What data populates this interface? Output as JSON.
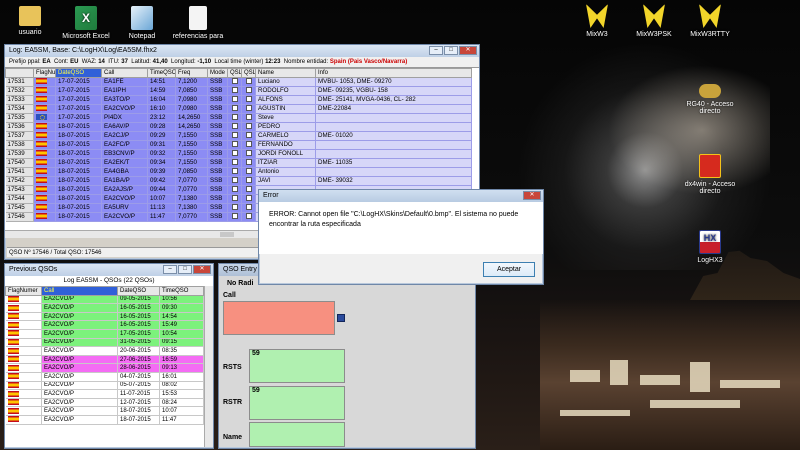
{
  "desktop": {
    "icons": [
      {
        "label": "usuario",
        "icon": "folder-icon",
        "color": "#e8c35a"
      },
      {
        "label": "Microsoft Excel",
        "icon": "excel-icon",
        "color": "#1f7a3c"
      },
      {
        "label": "Notepad",
        "icon": "notepad-icon",
        "color": "#6aa6d6"
      },
      {
        "label": "referencias para",
        "icon": "document-icon",
        "color": "#f4f4f4"
      },
      {
        "label": "MixW3",
        "icon": "mixw-butterfly-icon",
        "color": "#f2d52a"
      },
      {
        "label": "MixW3PSK",
        "icon": "mixw-butterfly-icon",
        "color": "#f2d52a"
      },
      {
        "label": "MixW3RTTY",
        "icon": "mixw-butterfly-icon",
        "color": "#f2d52a"
      },
      {
        "label": "RG40 - Acceso directo",
        "icon": "key-icon",
        "color": "#c9a33b"
      },
      {
        "label": "dx4win - Acceso directo",
        "icon": "dx4win-icon",
        "color": "#d62a1e"
      },
      {
        "label": "LogHX3",
        "icon": "loghx-icon",
        "color": "#c8202a"
      }
    ]
  },
  "log_window": {
    "title": "Log: EA5SM, Base: C:\\LogHX\\Log\\EA5SM.fhx2",
    "strip": {
      "prefijo_label": "Prefijo ppal:",
      "prefijo": "EA",
      "cont_label": "Cont:",
      "cont": "EU",
      "waz_label": "WAZ:",
      "waz": "14",
      "itu_label": "ITU:",
      "itu": "37",
      "lat_label": "Latitud:",
      "lat": "41,40",
      "lon_label": "Longitud:",
      "lon": "-1,10",
      "local_label": "Local time (winter)",
      "local": "12:23",
      "entity_label": "Nombre entidad:",
      "entity": "Spain (Pais Vasco/Navarra)"
    },
    "columns": [
      "",
      "FlagNur",
      "DateQSO",
      "Call",
      "TimeQSO",
      "Freq",
      "Mode",
      "QSLR",
      "QSLS",
      "Name",
      "Info"
    ],
    "rows": [
      {
        "idx": "17531",
        "flag": "es",
        "date": "17-07-2015",
        "call": "EA1FE",
        "time": "14:51",
        "freq": "7,1200",
        "mode": "SSB",
        "name": "Luciano",
        "info": "MVBU- 1053, DME- 09270"
      },
      {
        "idx": "17532",
        "flag": "es",
        "date": "17-07-2015",
        "call": "EA1IPH",
        "time": "14:59",
        "freq": "7,0850",
        "mode": "SSB",
        "name": "RODOLFO",
        "info": "DME- 09235, VGBU- 158"
      },
      {
        "idx": "17533",
        "flag": "es",
        "date": "17-07-2015",
        "call": "EA3TO/P",
        "time": "16:04",
        "freq": "7,0980",
        "mode": "SSB",
        "name": "ALFONS",
        "info": "DME- 25141, MVGA-0436, CL- 282"
      },
      {
        "idx": "17534",
        "flag": "es",
        "date": "17-07-2015",
        "call": "EA2CVO/P",
        "time": "16:10",
        "freq": "7,0980",
        "mode": "SSB",
        "name": "AGUSTIN",
        "info": "DME-22084"
      },
      {
        "idx": "17535",
        "flag": "eu",
        "date": "17-07-2015",
        "call": "PI4DX",
        "time": "23:12",
        "freq": "14,2650",
        "mode": "SSB",
        "name": "Steve",
        "info": ""
      },
      {
        "idx": "17536",
        "flag": "es",
        "date": "18-07-2015",
        "call": "EA6AV/P",
        "time": "09:28",
        "freq": "14,2650",
        "mode": "SSB",
        "name": "PEDRO",
        "info": ""
      },
      {
        "idx": "17537",
        "flag": "es",
        "date": "18-07-2015",
        "call": "EA2CJ/P",
        "time": "09:29",
        "freq": "7,1550",
        "mode": "SSB",
        "name": "CARMELO",
        "info": "DME- 01020"
      },
      {
        "idx": "17538",
        "flag": "es",
        "date": "18-07-2015",
        "call": "EA2FC/P",
        "time": "09:31",
        "freq": "7,1550",
        "mode": "SSB",
        "name": "FERNANDO",
        "info": ""
      },
      {
        "idx": "17539",
        "flag": "es",
        "date": "18-07-2015",
        "call": "EB3CNV/P",
        "time": "09:32",
        "freq": "7,1550",
        "mode": "SSB",
        "name": "JORDI FONOLL",
        "info": ""
      },
      {
        "idx": "17540",
        "flag": "es",
        "date": "18-07-2015",
        "call": "EA2EK/T",
        "time": "09:34",
        "freq": "7,1550",
        "mode": "SSB",
        "name": "ITZIAR",
        "info": "DME- 11035"
      },
      {
        "idx": "17541",
        "flag": "es",
        "date": "18-07-2015",
        "call": "EA4GBA",
        "time": "09:39",
        "freq": "7,0850",
        "mode": "SSB",
        "name": "Antonio",
        "info": ""
      },
      {
        "idx": "17542",
        "flag": "es",
        "date": "18-07-2015",
        "call": "EA1BA/P",
        "time": "09:42",
        "freq": "7,0770",
        "mode": "SSB",
        "name": "JAVI",
        "info": "DME- 39032"
      },
      {
        "idx": "17543",
        "flag": "es",
        "date": "18-07-2015",
        "call": "EA2AJS/P",
        "time": "09:44",
        "freq": "7,0770",
        "mode": "SSB",
        "name": "",
        "info": ""
      },
      {
        "idx": "17544",
        "flag": "es",
        "date": "18-07-2015",
        "call": "EA2CVO/P",
        "time": "10:07",
        "freq": "7,1380",
        "mode": "SSB",
        "name": "",
        "info": ""
      },
      {
        "idx": "17545",
        "flag": "es",
        "date": "18-07-2015",
        "call": "EA5URV",
        "time": "11:13",
        "freq": "7,1380",
        "mode": "SSB",
        "name": "",
        "info": ""
      },
      {
        "idx": "17546",
        "flag": "es",
        "date": "18-07-2015",
        "call": "EA2CVO/P",
        "time": "11:47",
        "freq": "7,0770",
        "mode": "SSB",
        "name": "",
        "info": ""
      }
    ],
    "status": "QSO Nº 17546 / Total QSO: 17546"
  },
  "prev_window": {
    "title": "Previous QSOs",
    "subtitle": "Log EA5SM - QSOs (22 QSOs)",
    "columns": [
      "FlagNumer",
      "Call",
      "DateQSO",
      "TimeQSO"
    ],
    "rows": [
      {
        "call": "EA2CVO/P",
        "date": "09-05-2015",
        "time": "10:56",
        "color": "#7cf27c"
      },
      {
        "call": "EA2CVO/P",
        "date": "16-05-2015",
        "time": "09:30",
        "color": "#7cf27c"
      },
      {
        "call": "EA2CVO/P",
        "date": "16-05-2015",
        "time": "14:54",
        "color": "#7cf27c"
      },
      {
        "call": "EA2CVO/P",
        "date": "16-05-2015",
        "time": "15:49",
        "color": "#7cf27c"
      },
      {
        "call": "EA2CVO/P",
        "date": "17-05-2015",
        "time": "10:54",
        "color": "#7cf27c"
      },
      {
        "call": "EA2CVO/P",
        "date": "31-05-2015",
        "time": "09:15",
        "color": "#7cf27c"
      },
      {
        "call": "EA2CVO/P",
        "date": "20-06-2015",
        "time": "08:35",
        "color": "#ffffff"
      },
      {
        "call": "EA2CVO/P",
        "date": "27-06-2015",
        "time": "16:59",
        "color": "#f46cf4"
      },
      {
        "call": "EA2CVO/P",
        "date": "28-06-2015",
        "time": "09:13",
        "color": "#f46cf4"
      },
      {
        "call": "EA2CVO/P",
        "date": "04-07-2015",
        "time": "16:01",
        "color": "#ffffff"
      },
      {
        "call": "EA2CVO/P",
        "date": "05-07-2015",
        "time": "08:02",
        "color": "#ffffff"
      },
      {
        "call": "EA2CVO/P",
        "date": "11-07-2015",
        "time": "15:53",
        "color": "#ffffff"
      },
      {
        "call": "EA2CVO/P",
        "date": "12-07-2015",
        "time": "08:24",
        "color": "#ffffff"
      },
      {
        "call": "EA2CVO/P",
        "date": "18-07-2015",
        "time": "10:07",
        "color": "#ffffff"
      },
      {
        "call": "EA2CVO/P",
        "date": "18-07-2015",
        "time": "11:47",
        "color": "#ffffff"
      }
    ]
  },
  "entry_window": {
    "title": "QSO Entry",
    "no_radio": "No Radi",
    "call_label": "Call",
    "rsts_label": "RSTS",
    "rsts": "59",
    "rstr_label": "RSTR",
    "rstr": "59",
    "name_label": "Name"
  },
  "error_dialog": {
    "title": "Error",
    "message": "ERROR: Cannot open file \"C:\\LogHX\\Skins\\Default\\0.bmp\". El sistema no puede encontrar la ruta especificada",
    "ok": "Aceptar"
  }
}
